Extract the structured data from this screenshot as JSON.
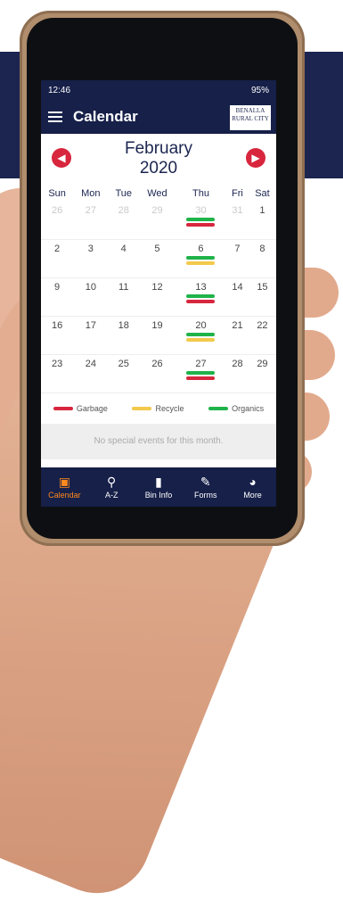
{
  "status_bar": {
    "time": "12:46",
    "battery": "95%"
  },
  "app_bar": {
    "title": "Calendar",
    "logo_text": "BENALLA RURAL CITY"
  },
  "calendar": {
    "month": "February",
    "year": "2020",
    "weekdays": [
      "Sun",
      "Mon",
      "Tue",
      "Wed",
      "Thu",
      "Fri",
      "Sat"
    ],
    "weeks": [
      [
        {
          "d": "26",
          "other": true
        },
        {
          "d": "27",
          "other": true
        },
        {
          "d": "28",
          "other": true
        },
        {
          "d": "29",
          "other": true
        },
        {
          "d": "30",
          "other": true,
          "bins": [
            "organics",
            "garbage"
          ]
        },
        {
          "d": "31",
          "other": true
        },
        {
          "d": "1"
        }
      ],
      [
        {
          "d": "2"
        },
        {
          "d": "3"
        },
        {
          "d": "4"
        },
        {
          "d": "5"
        },
        {
          "d": "6",
          "bins": [
            "organics",
            "recycle"
          ]
        },
        {
          "d": "7"
        },
        {
          "d": "8"
        }
      ],
      [
        {
          "d": "9"
        },
        {
          "d": "10"
        },
        {
          "d": "11"
        },
        {
          "d": "12"
        },
        {
          "d": "13",
          "bins": [
            "organics",
            "garbage"
          ]
        },
        {
          "d": "14"
        },
        {
          "d": "15"
        }
      ],
      [
        {
          "d": "16"
        },
        {
          "d": "17"
        },
        {
          "d": "18"
        },
        {
          "d": "19"
        },
        {
          "d": "20",
          "bins": [
            "organics",
            "recycle"
          ]
        },
        {
          "d": "21"
        },
        {
          "d": "22"
        }
      ],
      [
        {
          "d": "23"
        },
        {
          "d": "24"
        },
        {
          "d": "25"
        },
        {
          "d": "26"
        },
        {
          "d": "27",
          "bins": [
            "organics",
            "garbage"
          ]
        },
        {
          "d": "28"
        },
        {
          "d": "29"
        }
      ]
    ]
  },
  "legend": [
    {
      "key": "garbage",
      "label": "Garbage",
      "color": "#d7263d"
    },
    {
      "key": "recycle",
      "label": "Recycle",
      "color": "#f2c94c"
    },
    {
      "key": "organics",
      "label": "Organics",
      "color": "#1fb34a"
    }
  ],
  "events_text": "No special events for this month.",
  "bottom_nav": [
    {
      "label": "Calendar",
      "icon": "calendar-icon",
      "active": true
    },
    {
      "label": "A-Z",
      "icon": "search-icon",
      "active": false
    },
    {
      "label": "Bin Info",
      "icon": "bin-icon",
      "active": false
    },
    {
      "label": "Forms",
      "icon": "pencil-icon",
      "active": false
    },
    {
      "label": "More",
      "icon": "more-icon",
      "active": false
    }
  ],
  "colors": {
    "brand": "#162049",
    "accent_red": "#d7263d",
    "active_nav": "#ff8a1f"
  }
}
